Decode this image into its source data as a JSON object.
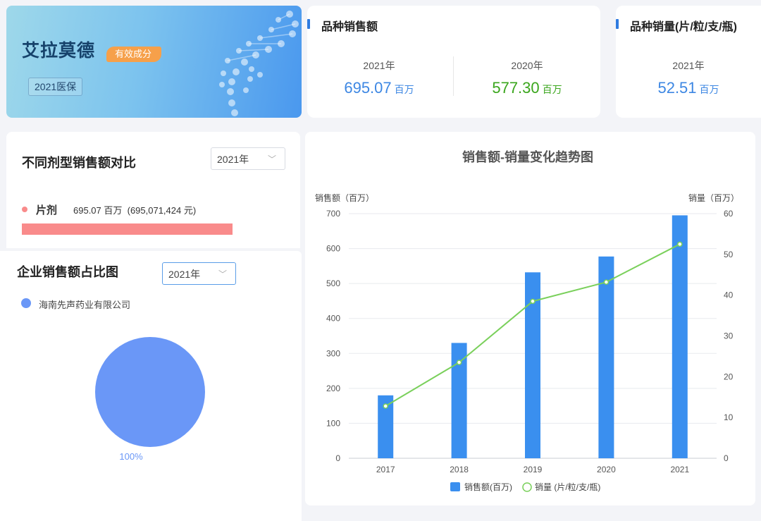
{
  "hero": {
    "title": "艾拉莫德",
    "tag": "有效成分",
    "badge": "2021医保"
  },
  "sales_card": {
    "title": "品种销售额",
    "items": [
      {
        "year": "2021年",
        "value": "695.07",
        "unit": "百万",
        "color": "#3d87e3"
      },
      {
        "year": "2020年",
        "value": "577.30",
        "unit": "百万",
        "color": "#3aa61c"
      }
    ]
  },
  "volume_card": {
    "title": "品种销量(片/粒/支/瓶)",
    "items": [
      {
        "year": "2021年",
        "value": "52.51",
        "unit": "百万",
        "color": "#3d87e3"
      }
    ]
  },
  "dosage_panel": {
    "title": "不同剂型销售额对比",
    "year_select": "2021年",
    "row": {
      "name": "片剂",
      "value": "695.07 百万",
      "detail": "(695,071,424 元)",
      "color": "#f98b8b",
      "fraction": 1.0
    }
  },
  "company_panel": {
    "title": "企业销售额占比图",
    "year_select": "2021年",
    "legend": "海南先声药业有限公司",
    "pie_label": "100%",
    "pie_color": "#6a97f7"
  },
  "chart_data": {
    "type": "bar",
    "title": "销售额-销量变化趋势图",
    "ylabel_left": "销售额（百万）",
    "ylabel_right": "销量（百万）",
    "categories": [
      "2017",
      "2018",
      "2019",
      "2020",
      "2021"
    ],
    "ylim_left": [
      0,
      700
    ],
    "ylim_right": [
      0,
      60
    ],
    "yticks_left": [
      "0",
      "100",
      "200",
      "300",
      "400",
      "500",
      "600",
      "700"
    ],
    "yticks_right": [
      "0",
      "10",
      "20",
      "30",
      "40",
      "50",
      "60"
    ],
    "series": [
      {
        "name": "销售额(百万)",
        "type": "bar",
        "axis": "left",
        "color": "#3a8fef",
        "values": [
          180,
          330,
          532,
          577.3,
          695.07
        ]
      },
      {
        "name": "销量 (片/粒/支/瓶)",
        "type": "line",
        "axis": "right",
        "color": "#7ad05b",
        "values": [
          12.8,
          23.5,
          38.5,
          43.2,
          52.51
        ]
      }
    ],
    "grid": true,
    "legend_position": "bottom"
  }
}
